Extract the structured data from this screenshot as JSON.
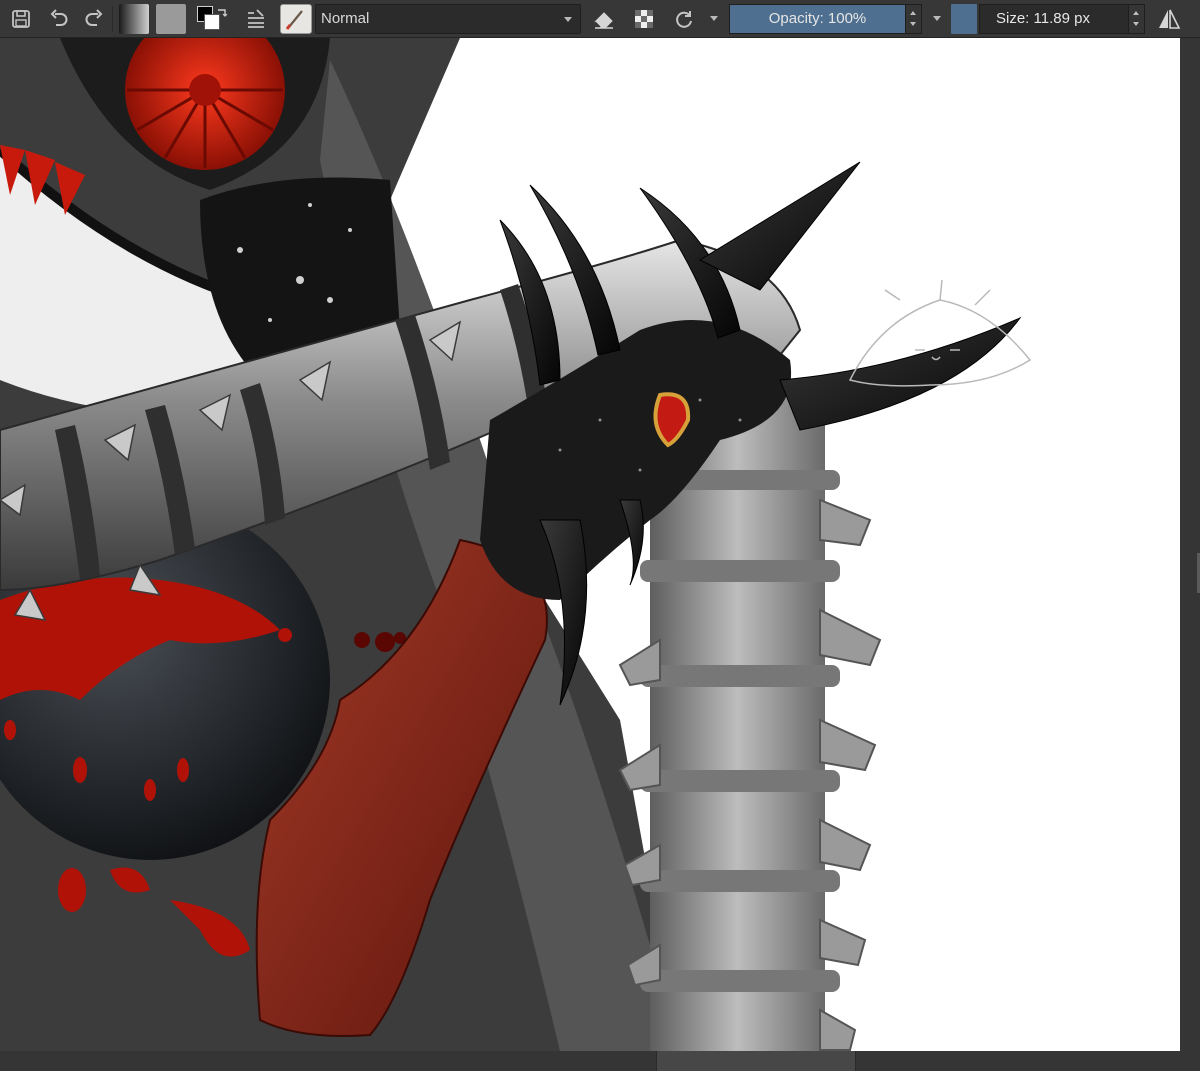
{
  "toolbar": {
    "icons": [
      "save-icon",
      "undo-icon",
      "redo-icon",
      "gradient-swatch",
      "pattern-swatch",
      "fg-bg-color-icon",
      "layer-settings-icon",
      "brush-preset-icon",
      "eraser-icon",
      "alpha-lock-icon",
      "reload-preset-icon",
      "mirror-icon"
    ],
    "blend_mode": "Normal",
    "opacity_label": "Opacity: 100%",
    "opacity_value": 1.0,
    "size_label": "Size: 11.89 px",
    "accent_color": "#4f6f90"
  },
  "canvas": {
    "background": "#ffffff"
  },
  "scrollbars": {
    "horizontal_position": 0.55,
    "vertical_position": 0.5
  }
}
